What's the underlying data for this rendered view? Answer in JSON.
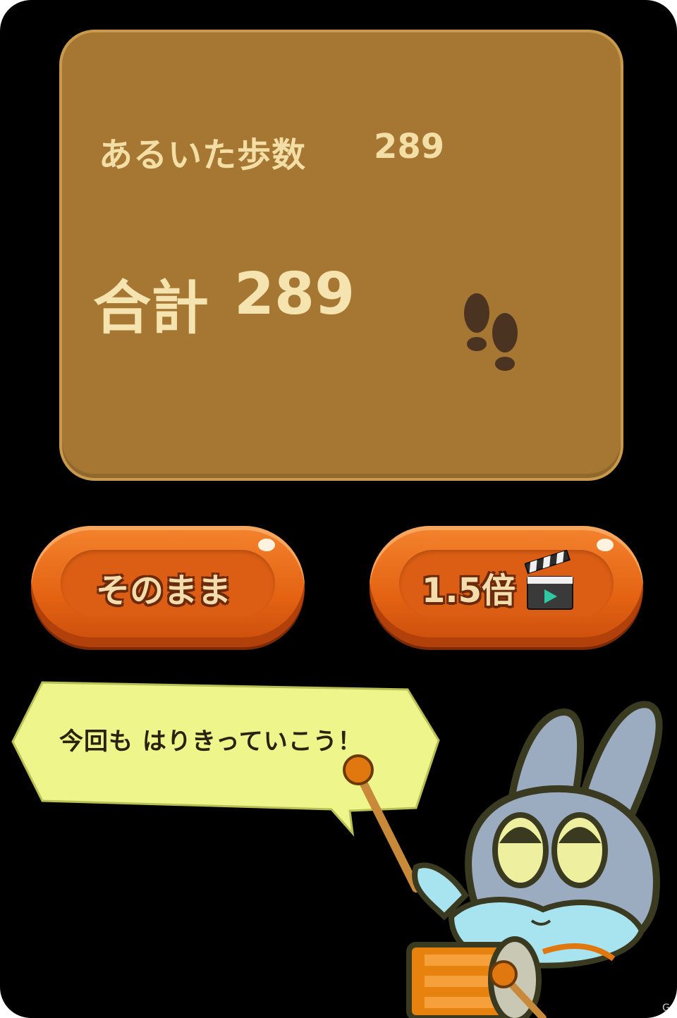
{
  "result_panel": {
    "steps_label": "あるいた歩数",
    "steps_value": "289",
    "total_label": "合計",
    "total_value": "289",
    "icon": "footprints-icon"
  },
  "buttons": {
    "keep_label": "そのまま",
    "boost_label": "1.5倍",
    "boost_icon": "clapperboard-play-icon"
  },
  "speech_bubble": {
    "text": "今回も はりきっていこう！"
  },
  "mascot": {
    "icon": "rabbit-drummer-icon"
  },
  "watermark": "G",
  "colors": {
    "panel": "#a67733",
    "panel_text": "#f3dfa6",
    "button": "#e36212",
    "bubble": "#eef58a"
  }
}
